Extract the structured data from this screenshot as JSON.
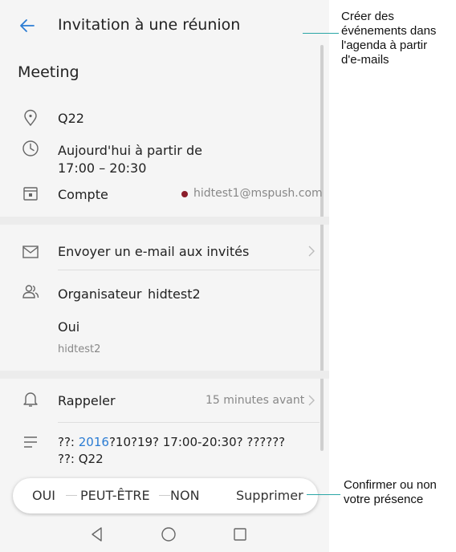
{
  "header": {
    "title": "Invitation à une réunion"
  },
  "event": {
    "title": "Meeting",
    "location": "Q22",
    "time_line1": "Aujourd'hui à partir de",
    "time_line2": "17:00 – 20:30",
    "account_label": "Compte",
    "account_email": "hidtest1@mspush.com",
    "account_color": "#8b1c2a"
  },
  "invite": {
    "email_label": "Envoyer un e-mail aux invités",
    "organizer_label": "Organisateur",
    "organizer_name": "hidtest2",
    "response": "Oui",
    "response_user": "hidtest2"
  },
  "reminder": {
    "label": "Rappeler",
    "value": "15 minutes avant"
  },
  "description": {
    "line1_prefix": "??: ",
    "line1_year": "2016",
    "line1_suffix": "?10?19? 17:00-20:30? ??????",
    "line2": "??: Q22",
    "year_color": "#2b7cd3"
  },
  "actions": {
    "yes": "OUI",
    "maybe": "PEUT-ÊTRE",
    "no": "NON",
    "delete": "Supprimer"
  },
  "annotations": {
    "top": [
      "Créer des",
      "événements dans",
      "l'agenda à partir",
      "d'e-mails"
    ],
    "bottom": [
      "Confirmer ou non",
      "votre présence"
    ],
    "line_color": "#2aa6a6"
  },
  "icons": {
    "back": "back-arrow-icon",
    "location": "location-pin-icon",
    "time": "clock-icon",
    "account": "calendar-icon",
    "email": "envelope-icon",
    "organizer": "people-icon",
    "reminder": "bell-icon",
    "description": "text-lines-icon",
    "nav_back": "nav-back-icon",
    "nav_home": "nav-home-icon",
    "nav_recent": "nav-recent-icon"
  }
}
